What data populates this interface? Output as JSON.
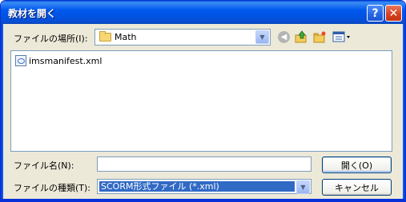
{
  "window": {
    "title": "教材を開く",
    "help_label": "?",
    "close_label": "✕"
  },
  "lookin": {
    "label": "ファイルの場所(I):",
    "value": "Math",
    "icons": [
      "back-icon",
      "up-folder-icon",
      "new-folder-icon",
      "views-menu-icon"
    ]
  },
  "files": [
    {
      "name": "imsmanifest.xml",
      "icon": "xml-file-icon"
    }
  ],
  "filename": {
    "label": "ファイル名(N):",
    "value": ""
  },
  "filetype": {
    "label": "ファイルの種類(T):",
    "value": "SCORM形式ファイル (*.xml)"
  },
  "buttons": {
    "open": "開く(O)",
    "cancel": "キャンセル"
  },
  "colors": {
    "titlebar": "#0058ee",
    "dialog_bg": "#ece9d8",
    "selection": "#316ac5"
  }
}
